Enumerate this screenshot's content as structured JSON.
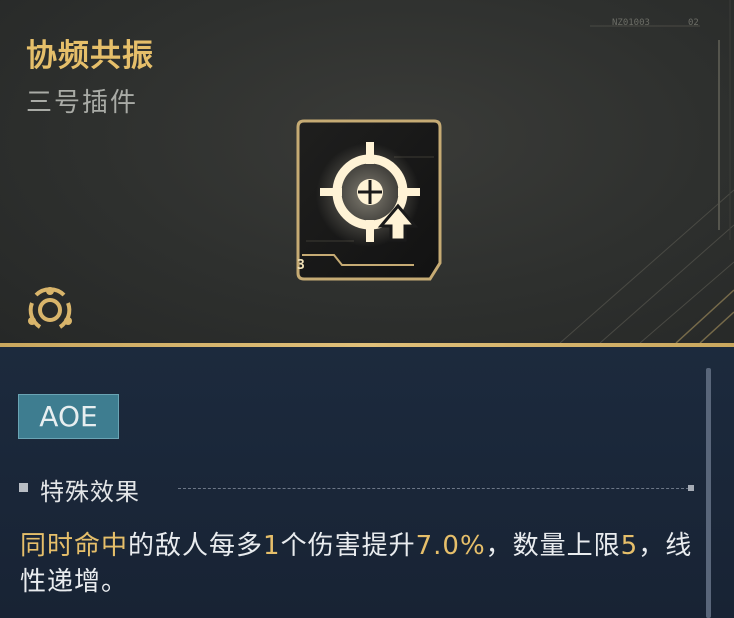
{
  "header": {
    "title": "协频共振",
    "subtitle": "三号插件",
    "corner_code_a": "NZ01003",
    "corner_code_b": "02"
  },
  "plugin": {
    "icon": "crosshair-up-arrow-icon",
    "level": "3"
  },
  "type_icon": "tri-node-hexagon-icon",
  "tag": "AOE",
  "section": {
    "title": "特殊效果"
  },
  "description": {
    "parts": [
      "同时命中",
      "的敌人每多",
      "1",
      "个伤害提升",
      "7.0%",
      "，数量上限",
      "5",
      "，线性递增。"
    ]
  },
  "colors": {
    "accent_gold": "#e6bf6a",
    "tag_bg": "#3e7d90",
    "bottom_bg": "#1c2a3d",
    "top_bg": "#2e302e"
  }
}
